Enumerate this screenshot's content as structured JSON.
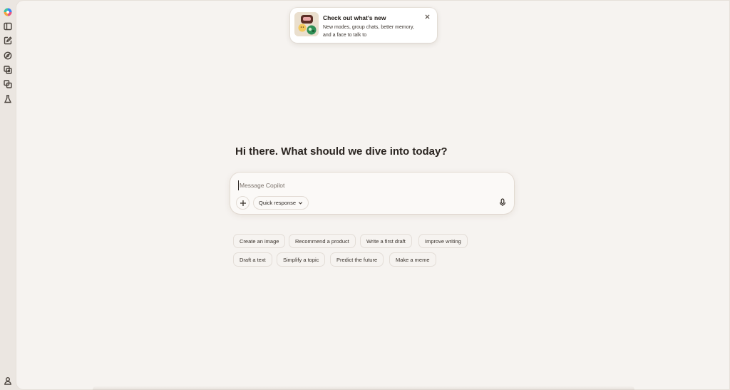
{
  "sidebar": {
    "items": [
      {
        "icon": "copilot-logo-icon"
      },
      {
        "icon": "sidebar-toggle-icon"
      },
      {
        "icon": "new-chat-icon"
      },
      {
        "icon": "discover-icon"
      },
      {
        "icon": "imagine-icon"
      },
      {
        "icon": "pages-icon"
      },
      {
        "icon": "labs-icon"
      }
    ],
    "bottom": {
      "icon": "profile-icon"
    }
  },
  "announcement": {
    "title": "Check out what’s new",
    "description": "New modes, group chats, better memory, and a face to talk to"
  },
  "greeting": "Hi there. What should we dive into today?",
  "composer": {
    "placeholder": "Message Copilot",
    "value": "",
    "mode_label": "Quick response"
  },
  "suggestions": {
    "row1": [
      "Create an image",
      "Recommend a product",
      "Write a first draft",
      "Improve writing"
    ],
    "row2": [
      "Draft a text",
      "Simplify a topic",
      "Predict the future",
      "Make a meme"
    ]
  },
  "colors": {
    "background": "#f6f3f0",
    "rail": "#ebe6e1",
    "card": "#ffffff",
    "text": "#2b2622"
  }
}
